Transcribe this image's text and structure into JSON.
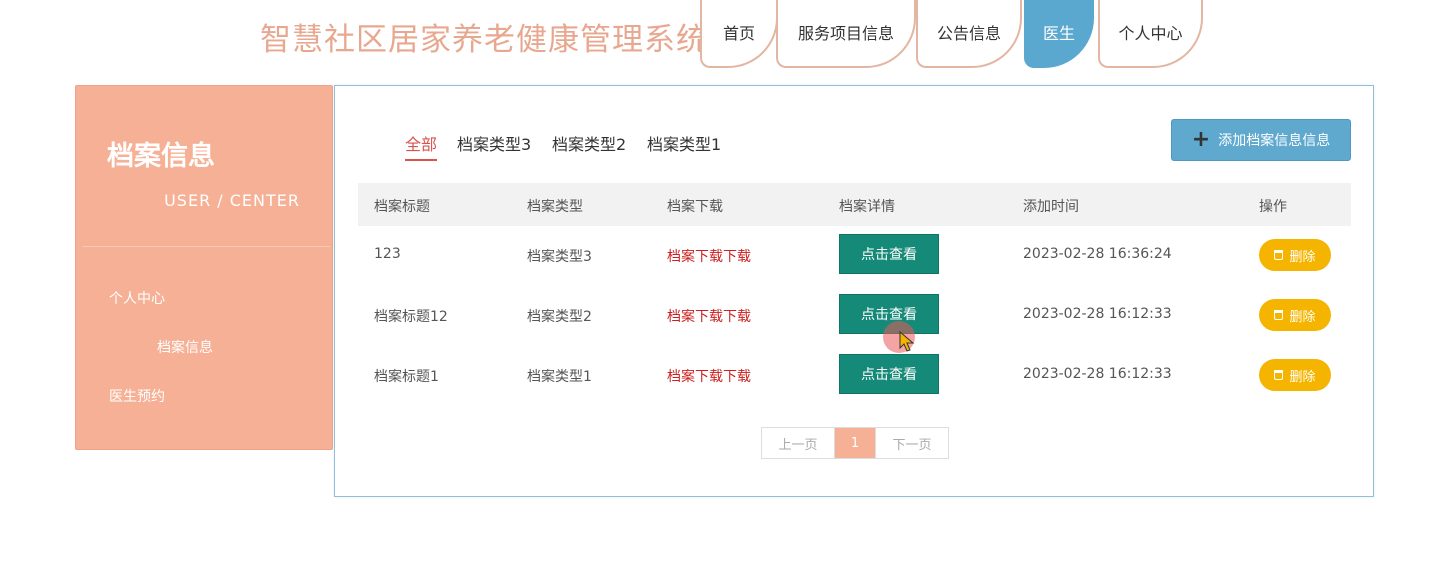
{
  "site": {
    "title": "智慧社区居家养老健康管理系统"
  },
  "nav": {
    "tabs": [
      {
        "label": "首页"
      },
      {
        "label": "服务项目信息"
      },
      {
        "label": "公告信息"
      },
      {
        "label": "医生"
      },
      {
        "label": "个人中心"
      }
    ],
    "active": "医生"
  },
  "sidebar": {
    "title": "档案信息",
    "subtitle": "USER / CENTER",
    "items": [
      {
        "label": "个人中心"
      },
      {
        "label": "档案信息"
      },
      {
        "label": "医生预约"
      }
    ]
  },
  "filters": {
    "items": [
      "全部",
      "档案类型3",
      "档案类型2",
      "档案类型1"
    ],
    "active": "全部"
  },
  "add_button": {
    "label": "添加档案信息信息"
  },
  "table": {
    "headers": [
      "档案标题",
      "档案类型",
      "档案下载",
      "档案详情",
      "添加时间",
      "操作"
    ],
    "rows": [
      {
        "title": "123",
        "type": "档案类型3",
        "download": "档案下载下载",
        "detail": "点击查看",
        "time": "2023-02-28 16:36:24",
        "action": "删除"
      },
      {
        "title": "档案标题12",
        "type": "档案类型2",
        "download": "档案下载下载",
        "detail": "点击查看",
        "time": "2023-02-28 16:12:33",
        "action": "删除"
      },
      {
        "title": "档案标题1",
        "type": "档案类型1",
        "download": "档案下载下载",
        "detail": "点击查看",
        "time": "2023-02-28 16:12:33",
        "action": "删除"
      }
    ]
  },
  "pagination": {
    "prev": "上一页",
    "current": "1",
    "next": "下一页"
  },
  "colors": {
    "title": "#e8a890",
    "sidebar_bg": "#f6b095",
    "nav_active": "#5aa8cf",
    "view_button": "#168a78",
    "delete_button": "#f5b400",
    "download_link": "#cc1f1f"
  }
}
